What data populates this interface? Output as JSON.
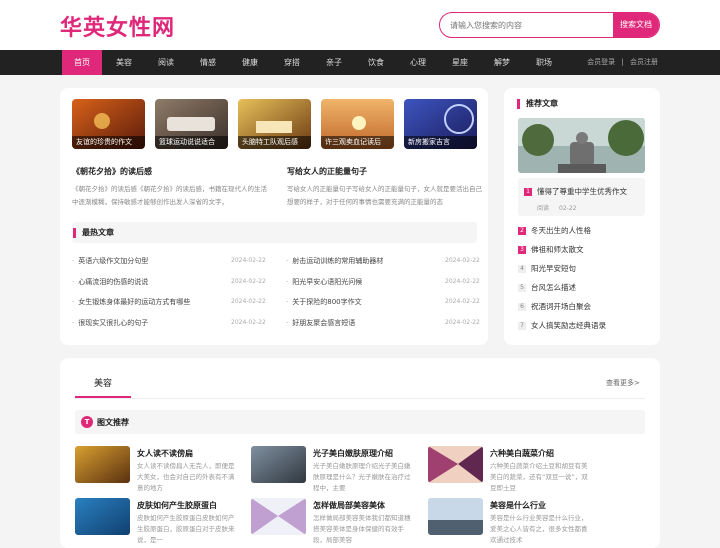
{
  "header": {
    "logo": "华英女性网",
    "search_placeholder": "请输入您搜索的内容",
    "search_button": "搜索文档"
  },
  "nav": {
    "items": [
      "首页",
      "美容",
      "阅读",
      "情感",
      "健康",
      "穿搭",
      "亲子",
      "饮食",
      "心理",
      "星座",
      "解梦",
      "职场"
    ],
    "login": "会员登录",
    "separator": "|",
    "register": "会员注册"
  },
  "featured": {
    "thumbs": [
      {
        "caption": "友谊的珍贵的作文",
        "color1": "#d8621a",
        "color2": "#5a1a0a"
      },
      {
        "caption": "篮球运动说说适合",
        "color1": "#8f7b68",
        "color2": "#3a2f2a"
      },
      {
        "caption": "头脑特工队观后感",
        "color1": "#e8c05a",
        "color2": "#6b3a12"
      },
      {
        "caption": "许三观卖血记读后",
        "color1": "#f0b46a",
        "color2": "#c0682a"
      },
      {
        "caption": "新房搬家吉言",
        "color1": "#3d55c0",
        "color2": "#1b1b5a"
      }
    ],
    "articles": [
      {
        "title": "《朝花夕拾》的读后感",
        "desc": "《朝花夕拾》的读后感《朝花夕拾》的读后感，书籍在现代人的生活中逐渐模糊，保持敏感才能够创作出发人深省的文字，"
      },
      {
        "title": "写给女人的正能量句子",
        "desc": "写给女人的正能量句子写给女人的正能量句子，女人就是要活出自己想要的样子，对于任何的事情也需要充满的正能量的态"
      }
    ]
  },
  "hot": {
    "heading": "最热文章",
    "left": [
      {
        "title": "英语六级作文加分句型",
        "date": "2024-02-22"
      },
      {
        "title": "心痛流泪的伤感的说说",
        "date": "2024-02-22"
      },
      {
        "title": "女生锻炼身体最好的运动方式有哪些",
        "date": "2024-02-22"
      },
      {
        "title": "很现实又很扎心的句子",
        "date": "2024-02-22"
      }
    ],
    "right": [
      {
        "title": "射击运动训练的常用辅助器材",
        "date": "2024-02-22"
      },
      {
        "title": "阳光早安心语阳光问候",
        "date": "2024-02-22"
      },
      {
        "title": "关于探险的800字作文",
        "date": "2024-02-22"
      },
      {
        "title": "好朋友聚会感言短语",
        "date": "2024-02-22"
      }
    ]
  },
  "recommend": {
    "heading": "推荐文章",
    "top": {
      "rank": "1",
      "title": "懂得了尊重中学生优秀作文",
      "meta_label": "阅读",
      "meta_date": "02-22"
    },
    "items": [
      {
        "rank": "2",
        "title": "冬天出生的人性格"
      },
      {
        "rank": "3",
        "title": "佛祖和师太散文"
      },
      {
        "rank": "4",
        "title": "阳光早安短句"
      },
      {
        "rank": "5",
        "title": "台风怎么描述"
      },
      {
        "rank": "6",
        "title": "祝酒词开场白聚会"
      },
      {
        "rank": "7",
        "title": "女人搞笑励志经典语录"
      }
    ]
  },
  "beauty": {
    "tab": "美容",
    "more": "查看更多>",
    "sub_icon": "T",
    "sub_heading": "图文推荐",
    "items": [
      {
        "title": "女人读不读傍扁",
        "desc": "女人读不读傍扁人无完人，即便是大美女，也会对自己的外表有不满意的地方",
        "color1": "#d9a030",
        "color2": "#5a3010"
      },
      {
        "title": "光子美白嫩肤原理介绍",
        "desc": "光子美白嫩肤原理介绍光子美白嫩肤原理是什么？光子嫩肤在治疗过程中，主要",
        "color1": "#8090a0",
        "color2": "#303840"
      },
      {
        "title": "六种美白蔬菜介绍",
        "desc": "六种美白蔬菜介绍土豆和胡豆有美美白的蔬菜，还有“双豆一说”，双豆即土豆",
        "color1": "#a04070",
        "color2": "#f0d0c0"
      },
      {
        "title": "皮肤如何产生胶原蛋白",
        "desc": "皮肤如何产生胶原蛋白皮肤如何产生胶原蛋白，胶原蛋白对于皮肤来说，是一",
        "color1": "#2a80c0",
        "color2": "#104070"
      },
      {
        "title": "怎样做局部美容美体",
        "desc": "怎样做局部美容美体我们都知道穗搭美容美体是身体保健的有效手段，局部美容",
        "color1": "#c0a0d0",
        "color2": "#f0f0f8"
      },
      {
        "title": "美容是什么行业",
        "desc": "美容是什么行业美容是什么行业，爱美之心人皆有之，很多女性都喜欢通过技术",
        "color1": "#c8d8e8",
        "color2": "#506070"
      }
    ]
  }
}
